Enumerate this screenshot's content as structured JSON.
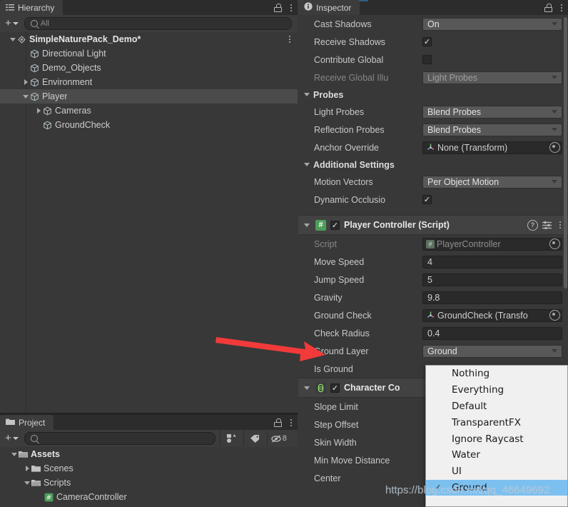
{
  "app": {
    "accent_blue": "#2c5d87",
    "bg": "#383838",
    "panel_bg": "#3c3c3c"
  },
  "hierarchy": {
    "tab_label": "Hierarchy",
    "tab_icon": "hierarchy-icon",
    "lock_icon": "lock-icon",
    "menu_icon": "kebab-menu-icon",
    "toolbar": {
      "create_label": "+",
      "search_placeholder": "All",
      "search_value": ""
    },
    "items": [
      {
        "label": "SimpleNaturePack_Demo*",
        "depth": 0,
        "foldout": "down",
        "icon": "scene-icon",
        "selected": false,
        "bold": true,
        "kebab": true
      },
      {
        "label": "Directional Light",
        "depth": 1,
        "foldout": "none",
        "icon": "gameobject-icon",
        "selected": false,
        "bold": false,
        "kebab": false
      },
      {
        "label": "Demo_Objects",
        "depth": 1,
        "foldout": "none",
        "icon": "gameobject-icon",
        "selected": false,
        "bold": false,
        "kebab": false
      },
      {
        "label": "Environment",
        "depth": 1,
        "foldout": "right",
        "icon": "gameobject-icon",
        "selected": false,
        "bold": false,
        "kebab": false
      },
      {
        "label": "Player",
        "depth": 1,
        "foldout": "down",
        "icon": "gameobject-icon",
        "selected": true,
        "bold": false,
        "kebab": false
      },
      {
        "label": "Cameras",
        "depth": 2,
        "foldout": "right",
        "icon": "gameobject-icon",
        "selected": false,
        "bold": false,
        "kebab": false
      },
      {
        "label": "GroundCheck",
        "depth": 2,
        "foldout": "none",
        "icon": "gameobject-icon",
        "selected": false,
        "bold": false,
        "kebab": false
      }
    ]
  },
  "project": {
    "tab_label": "Project",
    "tab_icon": "folder-icon",
    "lock_icon": "lock-icon",
    "menu_icon": "kebab-menu-icon",
    "toolbar": {
      "create_label": "+",
      "search_placeholder": "",
      "search_value": "",
      "buttons": [
        {
          "name": "filter-by-type-icon",
          "glyph": ""
        },
        {
          "name": "filter-by-label-icon",
          "glyph": ""
        },
        {
          "name": "hidden-packages-count",
          "glyph": "8"
        }
      ]
    },
    "items": [
      {
        "label": "Assets",
        "depth": 0,
        "foldout": "down",
        "icon": "folder-open-icon",
        "bold": true
      },
      {
        "label": "Scenes",
        "depth": 1,
        "foldout": "right",
        "icon": "folder-icon",
        "bold": false
      },
      {
        "label": "Scripts",
        "depth": 1,
        "foldout": "down",
        "icon": "folder-open-icon",
        "bold": false
      },
      {
        "label": "CameraController",
        "depth": 2,
        "foldout": "none",
        "icon": "script-icon",
        "bold": false
      }
    ]
  },
  "inspector": {
    "tab_label": "Inspector",
    "tab_icon": "info-icon",
    "lock_icon": "lock-icon",
    "menu_icon": "kebab-menu-icon",
    "renderer_rows": [
      {
        "label": "Cast Shadows",
        "type": "dropdown",
        "value": "On",
        "dim": false
      },
      {
        "label": "Receive Shadows",
        "type": "checkbox",
        "value": "checked",
        "dim": false
      },
      {
        "label": "Contribute Global",
        "type": "checkbox",
        "value": "unchecked",
        "dim": false
      },
      {
        "label": "Receive Global Illu",
        "type": "dropdown",
        "value": "Light Probes",
        "dim": true
      }
    ],
    "probes_section": "Probes",
    "probes_rows": [
      {
        "label": "Light Probes",
        "type": "dropdown",
        "value": "Blend Probes"
      },
      {
        "label": "Reflection Probes",
        "type": "dropdown",
        "value": "Blend Probes"
      },
      {
        "label": "Anchor Override",
        "type": "object",
        "value": "None (Transform)"
      }
    ],
    "additional_section": "Additional Settings",
    "additional_rows": [
      {
        "label": "Motion Vectors",
        "type": "dropdown",
        "value": "Per Object Motion"
      },
      {
        "label": "Dynamic Occlusio",
        "type": "checkbox",
        "value": "checked"
      }
    ],
    "player_controller": {
      "title": "Player Controller (Script)",
      "icon": "csharp-script-icon",
      "enabled": true,
      "help_icon": "help-icon",
      "preset_icon": "preset-icon",
      "menu_icon": "kebab-menu-icon",
      "rows": [
        {
          "label": "Script",
          "type": "object-dim",
          "value": "PlayerController"
        },
        {
          "label": "Move Speed",
          "type": "field",
          "value": "4"
        },
        {
          "label": "Jump Speed",
          "type": "field",
          "value": "5"
        },
        {
          "label": "Gravity",
          "type": "field",
          "value": "9.8"
        },
        {
          "label": "Ground Check",
          "type": "object",
          "value": "GroundCheck (Transfo"
        },
        {
          "label": "Check Radius",
          "type": "field",
          "value": "0.4"
        },
        {
          "label": "Ground Layer",
          "type": "dropdown",
          "value": "Ground"
        },
        {
          "label": "Is Ground",
          "type": "empty",
          "value": ""
        }
      ]
    },
    "character_controller": {
      "title": "Character Co",
      "icon": "capsule-collider-icon",
      "enabled": true,
      "rows": [
        {
          "label": "Slope Limit",
          "value": ""
        },
        {
          "label": "Step Offset",
          "value": ""
        },
        {
          "label": "Skin Width",
          "value": ""
        },
        {
          "label": "Min Move Distance",
          "value": ""
        },
        {
          "label": "Center",
          "value": ""
        }
      ]
    }
  },
  "layer_dropdown": {
    "open": true,
    "selected": "Ground",
    "options": [
      {
        "label": "Nothing",
        "checked": false
      },
      {
        "label": "Everything",
        "checked": false
      },
      {
        "label": "Default",
        "checked": false
      },
      {
        "label": "TransparentFX",
        "checked": false
      },
      {
        "label": "Ignore Raycast",
        "checked": false
      },
      {
        "label": "Water",
        "checked": false
      },
      {
        "label": "UI",
        "checked": false
      },
      {
        "label": "Ground",
        "checked": true
      }
    ]
  },
  "annotation": {
    "arrow_color": "#f23a3a",
    "arrow_points_to": "Ground Layer"
  },
  "watermark": {
    "text": "https://blog.csdn.net/qq_46649692"
  }
}
